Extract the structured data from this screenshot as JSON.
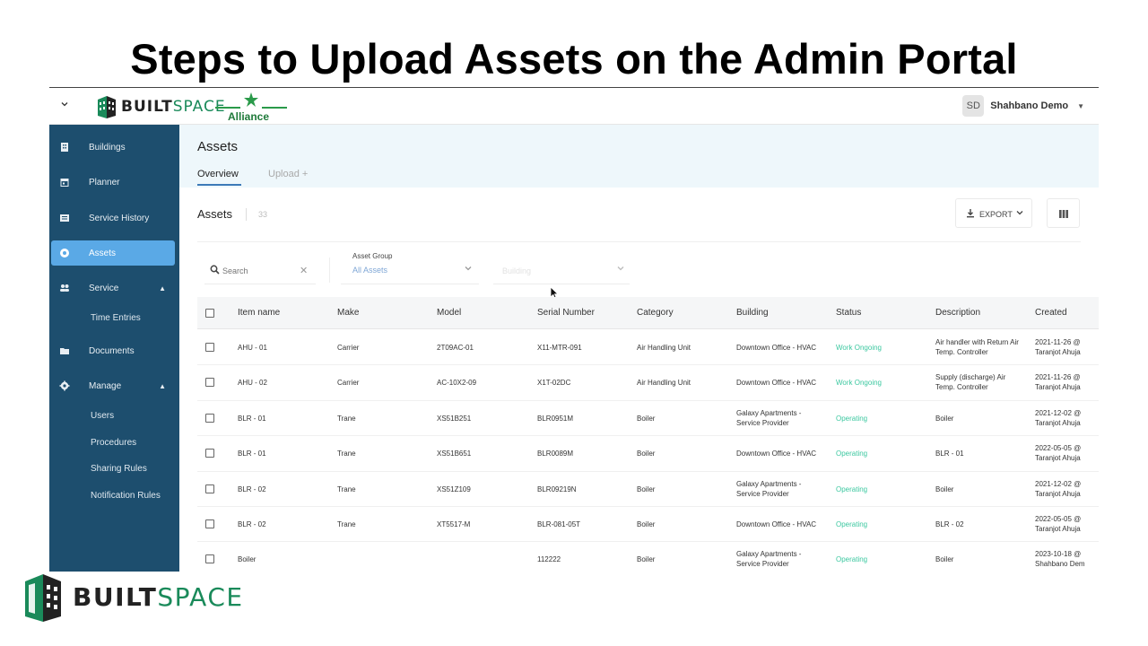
{
  "slide": {
    "title": "Steps to Upload Assets on the Admin Portal"
  },
  "topbar": {
    "logo_text_bold": "BUILT",
    "logo_text_light": "SPACE",
    "partner_logo": "Alliance",
    "user_initials": "SD",
    "user_name": "Shahbano Demo"
  },
  "sidebar": {
    "items": [
      {
        "label": "Buildings",
        "icon": "building-icon"
      },
      {
        "label": "Planner",
        "icon": "calendar-icon"
      },
      {
        "label": "Service History",
        "icon": "history-icon"
      },
      {
        "label": "Assets",
        "icon": "asset-icon",
        "active": true
      },
      {
        "label": "Service",
        "icon": "people-icon",
        "expanded": true
      },
      {
        "label": "Documents",
        "icon": "folder-icon"
      },
      {
        "label": "Manage",
        "icon": "gear-icon",
        "expanded": true
      }
    ],
    "service_sub": [
      "Time Entries"
    ],
    "manage_sub": [
      "Users",
      "Procedures",
      "Sharing Rules",
      "Notification Rules"
    ]
  },
  "main": {
    "title": "Assets",
    "tabs": [
      "Overview",
      "Upload +"
    ],
    "section_title": "Assets",
    "section_count": "33",
    "export_label": "EXPORT",
    "search_placeholder": "Search",
    "asset_group_label": "Asset Group",
    "asset_group_value": "All Assets",
    "building_placeholder": "Building"
  },
  "table": {
    "columns": [
      "Item name",
      "Make",
      "Model",
      "Serial Number",
      "Category",
      "Building",
      "Status",
      "Description",
      "Created"
    ],
    "rows": [
      {
        "item": "AHU - 01",
        "make": "Carrier",
        "model": "2T09AC-01",
        "serial": "X11-MTR-091",
        "category": "Air Handling Unit",
        "building": [
          "Downtown Office - HVAC"
        ],
        "status": "Work Ongoing",
        "description": [
          "Air handler with Return Air",
          "Temp. Controller"
        ],
        "created": [
          "2021-11-26 @",
          "Taranjot Ahuja"
        ]
      },
      {
        "item": "AHU - 02",
        "make": "Carrier",
        "model": "AC-10X2-09",
        "serial": "X1T-02DC",
        "category": "Air Handling Unit",
        "building": [
          "Downtown Office - HVAC"
        ],
        "status": "Work Ongoing",
        "description": [
          "Supply (discharge) Air",
          "Temp. Controller"
        ],
        "created": [
          "2021-11-26 @",
          "Taranjot Ahuja"
        ]
      },
      {
        "item": "BLR - 01",
        "make": "Trane",
        "model": "XS51B251",
        "serial": "BLR0951M",
        "category": "Boiler",
        "building": [
          "Galaxy Apartments -",
          "Service Provider"
        ],
        "status": "Operating",
        "description": [
          "Boiler"
        ],
        "created": [
          "2021-12-02 @",
          "Taranjot Ahuja"
        ]
      },
      {
        "item": "BLR - 01",
        "make": "Trane",
        "model": "XS51B651",
        "serial": "BLR0089M",
        "category": "Boiler",
        "building": [
          "Downtown Office - HVAC"
        ],
        "status": "Operating",
        "description": [
          "BLR - 01"
        ],
        "created": [
          "2022-05-05 @",
          "Taranjot Ahuja"
        ]
      },
      {
        "item": "BLR - 02",
        "make": "Trane",
        "model": "XS51Z109",
        "serial": "BLR09219N",
        "category": "Boiler",
        "building": [
          "Galaxy Apartments -",
          "Service Provider"
        ],
        "status": "Operating",
        "description": [
          "Boiler"
        ],
        "created": [
          "2021-12-02 @",
          "Taranjot Ahuja"
        ]
      },
      {
        "item": "BLR - 02",
        "make": "Trane",
        "model": "XT5517-M",
        "serial": "BLR-081-05T",
        "category": "Boiler",
        "building": [
          "Downtown Office - HVAC"
        ],
        "status": "Operating",
        "description": [
          "BLR - 02"
        ],
        "created": [
          "2022-05-05 @",
          "Taranjot Ahuja"
        ]
      },
      {
        "item": "Boiler",
        "make": "",
        "model": "",
        "serial": "112222",
        "category": "Boiler",
        "building": [
          "Galaxy Apartments -",
          "Service Provider"
        ],
        "status": "Operating",
        "description": [
          "Boiler"
        ],
        "created": [
          "2023-10-18 @",
          "Shahbano Dem"
        ]
      }
    ]
  },
  "footer_logo": {
    "bold": "BUILT",
    "light": "SPACE"
  },
  "colors": {
    "sidebar": "#1d4e6e",
    "active_nav": "#5aa9e6",
    "status_green": "#3cc8a0",
    "brand_green": "#1a8a5a"
  }
}
